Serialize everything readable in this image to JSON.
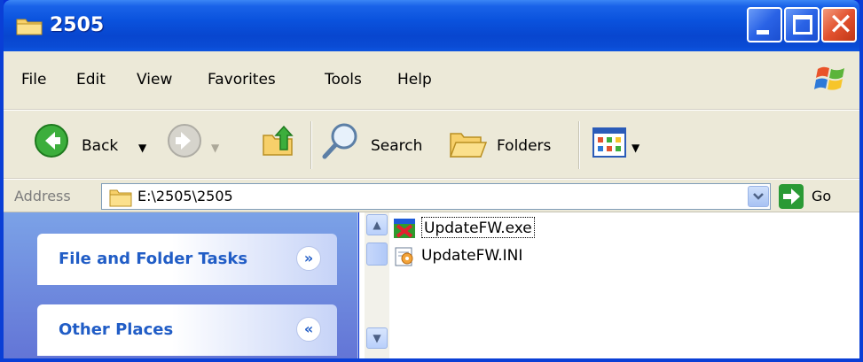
{
  "window": {
    "title": "2505"
  },
  "menu": [
    "File",
    "Edit",
    "View",
    "Favorites",
    "Tools",
    "Help"
  ],
  "toolbar": {
    "back_label": "Back",
    "search_label": "Search",
    "folders_label": "Folders"
  },
  "address": {
    "label": "Address",
    "value": "E:\\2505\\2505",
    "go_label": "Go"
  },
  "tasks": [
    {
      "title": "File and Folder Tasks",
      "state": "collapsed"
    },
    {
      "title": "Other Places",
      "state": "expanded"
    }
  ],
  "files": [
    {
      "name": "UpdateFW.exe",
      "icon": "exe-icon",
      "selected": true
    },
    {
      "name": "UpdateFW.INI",
      "icon": "ini-settings-icon",
      "selected": false
    }
  ],
  "colors": {
    "titlebar": "#0a52dd",
    "chrome": "#ece9d8",
    "taskpane": "#7ba2e7",
    "task_title": "#215dc6",
    "close": "#e2522f"
  }
}
